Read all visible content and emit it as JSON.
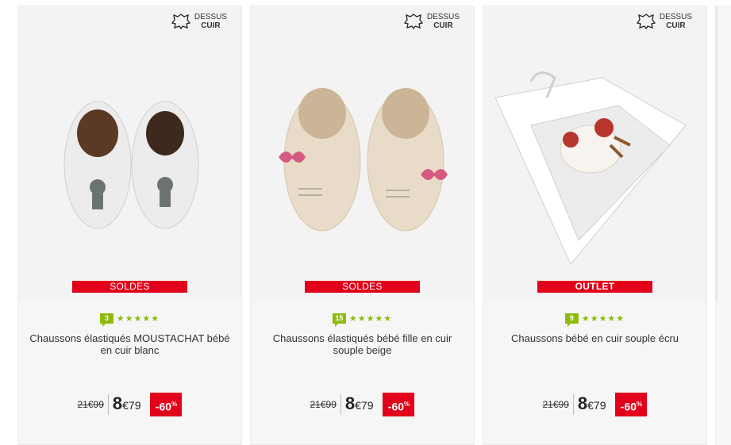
{
  "leather_badge": {
    "line1": "DESSUS",
    "line2": "CUIR"
  },
  "products": [
    {
      "badge": "SOLDES",
      "rating_count": "3",
      "stars": "★★★★★",
      "title": "Chaussons élastiqués MOUSTACHAT bébé en cuir blanc",
      "old_price": "21€99",
      "new_price_main": "8",
      "new_price_cents": "€79",
      "discount": "-60",
      "discount_sup": "%"
    },
    {
      "badge": "SOLDES",
      "rating_count": "15",
      "stars": "★★★★★",
      "title": "Chaussons élastiqués bébé fille en cuir souple beige",
      "old_price": "21€99",
      "new_price_main": "8",
      "new_price_cents": "€79",
      "discount": "-60",
      "discount_sup": "%"
    },
    {
      "badge": "OUTLET",
      "rating_count": "9",
      "stars": "★★★★★",
      "title": "Chaussons bébé en cuir souple écru",
      "old_price": "21€99",
      "new_price_main": "8",
      "new_price_cents": "€79",
      "discount": "-60",
      "discount_sup": "%"
    }
  ],
  "colors": {
    "sale_red": "#e2001a",
    "rating_green": "#8cbb0e"
  }
}
